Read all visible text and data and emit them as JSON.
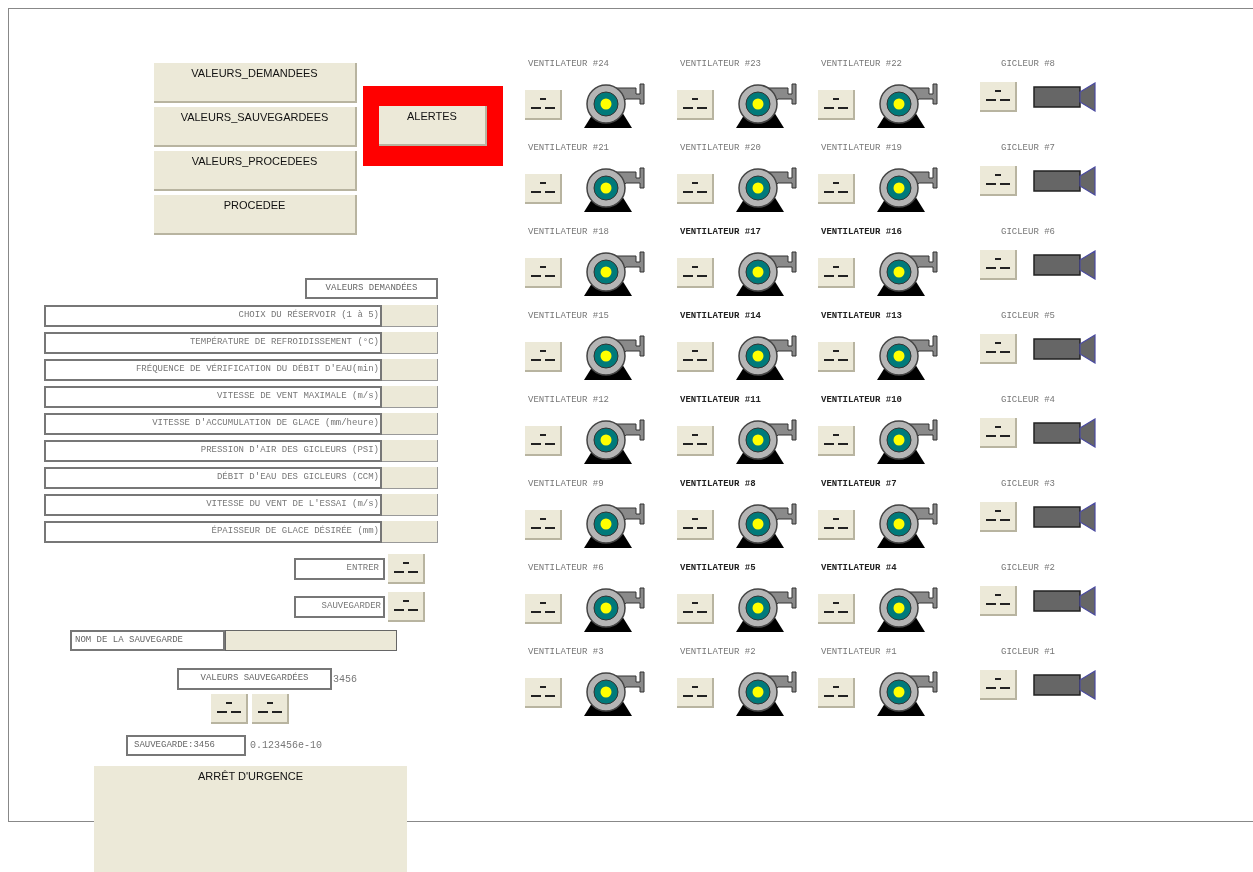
{
  "menu_buttons": [
    "VALEURS_DEMANDEES",
    "VALEURS_SAUVEGARDEES",
    "VALEURS_PROCEDEES",
    "PROCEDEE"
  ],
  "alert_button": {
    "label": "ALERTES",
    "alarm": true
  },
  "requested_values": {
    "title": "VALEURS DEMANDÉES",
    "fields": [
      {
        "label": "CHOIX DU RÉSERVOIR (1 à 5)"
      },
      {
        "label": "TEMPÉRATURE DE REFROIDISSEMENT (°C)"
      },
      {
        "label": "FRÉQUENCE DE VÉRIFICATION DU DÉBIT D'EAU(min)"
      },
      {
        "label": "VITESSE DE VENT MAXIMALE (m/s)"
      },
      {
        "label": "VITESSE D'ACCUMULATION DE GLACE (mm/heure)"
      },
      {
        "label": "PRESSION D'AIR DES GICLEURS (PSI)"
      },
      {
        "label": "DÉBIT D'EAU DES GICLEURS (CCM)"
      },
      {
        "label": "VITESSE DU VENT DE L'ESSAI (m/s)"
      },
      {
        "label": "ÉPAISSEUR DE GLACE DÉSIRÉE (mm)"
      }
    ]
  },
  "enter_label": "ENTRER",
  "save_label": "SAUVEGARDER",
  "save_name": {
    "label": "NOM DE LA SAUVEGARDE"
  },
  "saved_values": {
    "label": "VALEURS SAUVEGARDÉES",
    "value": "3456"
  },
  "save_info": {
    "label": "SAUVEGARDE:3456",
    "value": "0.123456e-10"
  },
  "emergency_button": "ARRÊT D'URGENCE",
  "devices": [
    [
      {
        "label": "VENTILATEUR #24",
        "kind": "fan",
        "bold": false
      },
      {
        "label": "VENTILATEUR #23",
        "kind": "fan",
        "bold": false
      },
      {
        "label": "VENTILATEUR #22",
        "kind": "fan",
        "bold": false
      },
      {
        "label": "GICLEUR #8",
        "kind": "nozzle",
        "bold": false
      }
    ],
    [
      {
        "label": "VENTILATEUR #21",
        "kind": "fan",
        "bold": false
      },
      {
        "label": "VENTILATEUR #20",
        "kind": "fan",
        "bold": false
      },
      {
        "label": "VENTILATEUR #19",
        "kind": "fan",
        "bold": false
      },
      {
        "label": "GICLEUR #7",
        "kind": "nozzle",
        "bold": false
      }
    ],
    [
      {
        "label": "VENTILATEUR #18",
        "kind": "fan",
        "bold": false
      },
      {
        "label": "VENTILATEUR #17",
        "kind": "fan",
        "bold": true
      },
      {
        "label": "VENTILATEUR #16",
        "kind": "fan",
        "bold": true
      },
      {
        "label": "GICLEUR #6",
        "kind": "nozzle",
        "bold": false
      }
    ],
    [
      {
        "label": "VENTILATEUR #15",
        "kind": "fan",
        "bold": false
      },
      {
        "label": "VENTILATEUR #14",
        "kind": "fan",
        "bold": true
      },
      {
        "label": "VENTILATEUR #13",
        "kind": "fan",
        "bold": true
      },
      {
        "label": "GICLEUR #5",
        "kind": "nozzle",
        "bold": false
      }
    ],
    [
      {
        "label": "VENTILATEUR #12",
        "kind": "fan",
        "bold": false
      },
      {
        "label": "VENTILATEUR #11",
        "kind": "fan",
        "bold": true
      },
      {
        "label": "VENTILATEUR #10",
        "kind": "fan",
        "bold": true
      },
      {
        "label": "GICLEUR #4",
        "kind": "nozzle",
        "bold": false
      }
    ],
    [
      {
        "label": "VENTILATEUR #9",
        "kind": "fan",
        "bold": false
      },
      {
        "label": "VENTILATEUR #8",
        "kind": "fan",
        "bold": true
      },
      {
        "label": "VENTILATEUR #7",
        "kind": "fan",
        "bold": true
      },
      {
        "label": "GICLEUR #3",
        "kind": "nozzle",
        "bold": false
      }
    ],
    [
      {
        "label": "VENTILATEUR #6",
        "kind": "fan",
        "bold": false
      },
      {
        "label": "VENTILATEUR #5",
        "kind": "fan",
        "bold": true
      },
      {
        "label": "VENTILATEUR #4",
        "kind": "fan",
        "bold": true
      },
      {
        "label": "GICLEUR #2",
        "kind": "nozzle",
        "bold": false
      }
    ],
    [
      {
        "label": "VENTILATEUR #3",
        "kind": "fan",
        "bold": false
      },
      {
        "label": "VENTILATEUR #2",
        "kind": "fan",
        "bold": false
      },
      {
        "label": "VENTILATEUR #1",
        "kind": "fan",
        "bold": false
      },
      {
        "label": "GICLEUR #1",
        "kind": "nozzle",
        "bold": false
      }
    ]
  ]
}
